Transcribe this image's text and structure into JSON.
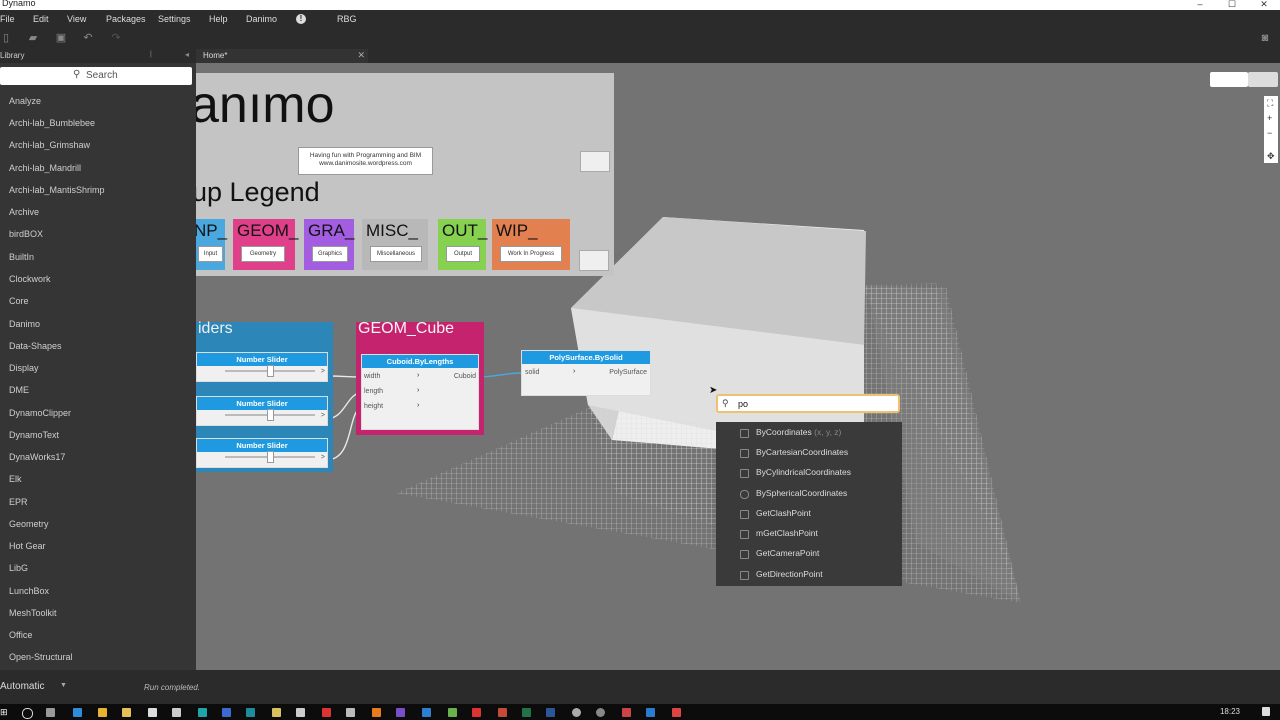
{
  "window": {
    "title": "Dynamo",
    "controls": [
      "–",
      "☐",
      "✕"
    ]
  },
  "menu": [
    "File",
    "Edit",
    "View",
    "Packages",
    "Settings",
    "Help",
    "Danimo",
    "RBG"
  ],
  "library": {
    "title": "Library",
    "search_placeholder": "Search",
    "items": [
      "Analyze",
      "Archi-lab_Bumblebee",
      "Archi-lab_Grimshaw",
      "Archi-lab_Mandrill",
      "Archi-lab_MantisShrimp",
      "Archive",
      "birdBOX",
      "BuiltIn",
      "Clockwork",
      "Core",
      "Danimo",
      "Data-Shapes",
      "Display",
      "DME",
      "DynamoClipper",
      "DynamoText",
      "DynaWorks17",
      "Elk",
      "EPR",
      "Geometry",
      "Hot Gear",
      "LibG",
      "LunchBox",
      "MeshToolkit",
      "Office",
      "Open-Structural"
    ]
  },
  "tab": {
    "label": "Home*",
    "close": "✕"
  },
  "canvas": {
    "brand": "anımo",
    "note": "Having fun with Programming and BIM www.danimosite.wordpress.com",
    "legend_title": "up Legend",
    "legend": [
      {
        "code": "NP_",
        "label": "Input",
        "color": "#4aa8de"
      },
      {
        "code": "GEOM_",
        "label": "Geometry",
        "color": "#e0408a"
      },
      {
        "code": "GRA_",
        "label": "Graphics",
        "color": "#a25de0"
      },
      {
        "code": "MISC_",
        "label": "Miscellaneous",
        "color": "#b8b8b8"
      },
      {
        "code": "OUT_",
        "label": "Output",
        "color": "#86d14f"
      },
      {
        "code": "WIP_",
        "label": "Work In Progress",
        "color": "#e38050"
      }
    ],
    "sliders_group": {
      "title": "iders",
      "color": "#2d86b8"
    },
    "sliders": [
      "Number Slider",
      "Number Slider",
      "Number Slider"
    ],
    "cube_group": {
      "title": "GEOM_Cube",
      "color": "#c6236e"
    },
    "cuboid_node": {
      "title": "Cuboid.ByLengths",
      "inputs": [
        "width",
        "length",
        "height"
      ],
      "output": "Cuboid"
    },
    "poly_node": {
      "title": "PolySurface.BySolid",
      "input": "solid",
      "output": "PolySurface"
    }
  },
  "search": {
    "value": "po",
    "results": [
      {
        "label": "ByCoordinates",
        "hint": "(x, y, z)"
      },
      {
        "label": "ByCartesianCoordinates",
        "hint": ""
      },
      {
        "label": "ByCylindricalCoordinates",
        "hint": ""
      },
      {
        "label": "BySphericalCoordinates",
        "hint": ""
      },
      {
        "label": "GetClashPoint",
        "hint": ""
      },
      {
        "label": "mGetClashPoint",
        "hint": ""
      },
      {
        "label": "GetCameraPoint",
        "hint": ""
      },
      {
        "label": "GetDirectionPoint",
        "hint": ""
      }
    ]
  },
  "status": {
    "run_mode": "Automatic",
    "message": "Run completed."
  },
  "taskbar": {
    "time": "18:23"
  }
}
